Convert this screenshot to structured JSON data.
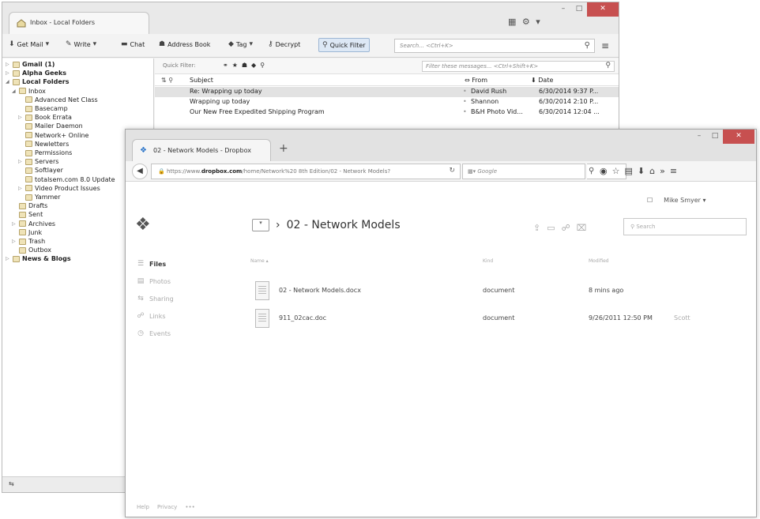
{
  "thunderbird": {
    "tab_title": "Inbox - Local Folders",
    "tray_icons": "▦ ⚙ ▾",
    "window_controls": {
      "min": "–",
      "max": "□",
      "close": "✕"
    },
    "toolbar": {
      "get_mail": "Get Mail",
      "write": "Write",
      "chat": "Chat",
      "address_book": "Address Book",
      "tag": "Tag",
      "decrypt": "Decrypt",
      "quick_filter": "Quick Filter",
      "search_placeholder": "Search... <Ctrl+K>"
    },
    "folders": [
      {
        "label": "Gmail (1)",
        "bold": true
      },
      {
        "label": "Alpha Geeks",
        "bold": true
      },
      {
        "label": "Local Folders",
        "bold": true
      },
      {
        "label": "Inbox",
        "bold": false
      },
      {
        "label": "Advanced Net Class",
        "bold": false
      },
      {
        "label": "Basecamp",
        "bold": false
      },
      {
        "label": "Book Errata",
        "bold": false
      },
      {
        "label": "Mailer Daemon",
        "bold": false
      },
      {
        "label": "Network+ Online",
        "bold": false
      },
      {
        "label": "Newletters",
        "bold": false
      },
      {
        "label": "Permissions",
        "bold": false
      },
      {
        "label": "Servers",
        "bold": false
      },
      {
        "label": "Softlayer",
        "bold": false
      },
      {
        "label": "totalsem.com 8.0 Update",
        "bold": false
      },
      {
        "label": "Video Product Issues",
        "bold": false
      },
      {
        "label": "Yammer",
        "bold": false
      },
      {
        "label": "Drafts",
        "bold": false
      },
      {
        "label": "Sent",
        "bold": false
      },
      {
        "label": "Archives",
        "bold": false
      },
      {
        "label": "Junk",
        "bold": false
      },
      {
        "label": "Trash",
        "bold": false
      },
      {
        "label": "Outbox",
        "bold": false
      },
      {
        "label": "News & Blogs",
        "bold": true
      }
    ],
    "quick_filter_bar": {
      "label": "Quick Filter:",
      "filter_placeholder": "Filter these messages... <Ctrl+Shift+K>"
    },
    "columns": {
      "subject": "Subject",
      "from": "From",
      "date": "Date"
    },
    "messages": [
      {
        "subject": "Re: Wrapping up today",
        "from": "David Rush",
        "date": "6/30/2014 9:37 P..."
      },
      {
        "subject": "Wrapping up today",
        "from": "Shannon",
        "date": "6/30/2014 2:10 P..."
      },
      {
        "subject": "Our New Free Expedited Shipping Program",
        "from": "B&H Photo Vid...",
        "date": "6/30/2014 12:04 ..."
      }
    ]
  },
  "firefox": {
    "tab_title": "02 - Network Models - Dropbox",
    "new_tab": "+",
    "url_prefix": "https://www.",
    "url_domain": "dropbox.com",
    "url_path": "/home/Network%20 8th Edition/02 - Network Models?",
    "search_engine": "Google",
    "window_controls": {
      "min": "–",
      "max": "□",
      "close": "✕"
    }
  },
  "dropbox": {
    "user_name": "Mike Smyer",
    "breadcrumb": "02 - Network Models",
    "search_placeholder": "Search",
    "nav": [
      {
        "label": "Files",
        "icon": "☰"
      },
      {
        "label": "Photos",
        "icon": "▤"
      },
      {
        "label": "Sharing",
        "icon": "⇆"
      },
      {
        "label": "Links",
        "icon": "☍"
      },
      {
        "label": "Events",
        "icon": "◷"
      }
    ],
    "columns": {
      "name": "Name",
      "kind": "Kind",
      "modified": "Modified"
    },
    "files": [
      {
        "name": "02 - Network Models.docx",
        "kind": "document",
        "modified": "8 mins ago"
      },
      {
        "name": "911_02cac.doc",
        "kind": "document",
        "modified": "9/26/2011 12:50 PM",
        "extra": "Scott"
      }
    ],
    "footer": {
      "help": "Help",
      "privacy": "Privacy",
      "more": "•••"
    }
  }
}
